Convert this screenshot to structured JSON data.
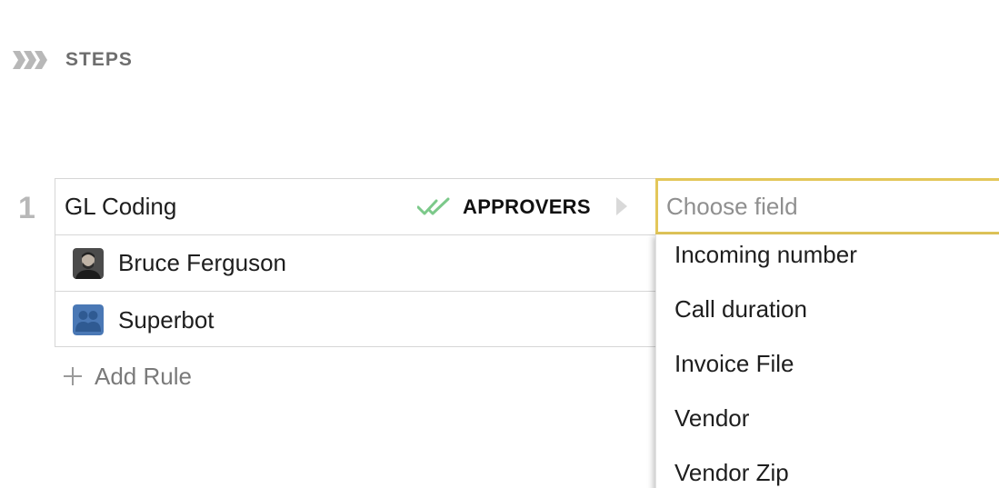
{
  "header": {
    "title": "STEPS",
    "icon": "steps-chevrons-icon"
  },
  "step": {
    "number": "1",
    "name": "GL Coding",
    "approvers_label": "APPROVERS",
    "approvers_icon": "double-check-icon",
    "approvers": [
      {
        "name": "Bruce Ferguson",
        "avatar": "user-photo-avatar"
      },
      {
        "name": "Superbot",
        "avatar": "group-avatar-icon"
      }
    ]
  },
  "add_rule": {
    "label": "Add Rule"
  },
  "field_select": {
    "placeholder": "Choose field",
    "value": "",
    "options": [
      "Incoming number",
      "Call duration",
      "Invoice File",
      "Vendor",
      "Vendor Zip"
    ]
  },
  "colors": {
    "accent_focus": "#e3c75a",
    "check_green": "#7cc98a",
    "muted_text": "#6e6e6e",
    "border": "#d6d6d6"
  }
}
